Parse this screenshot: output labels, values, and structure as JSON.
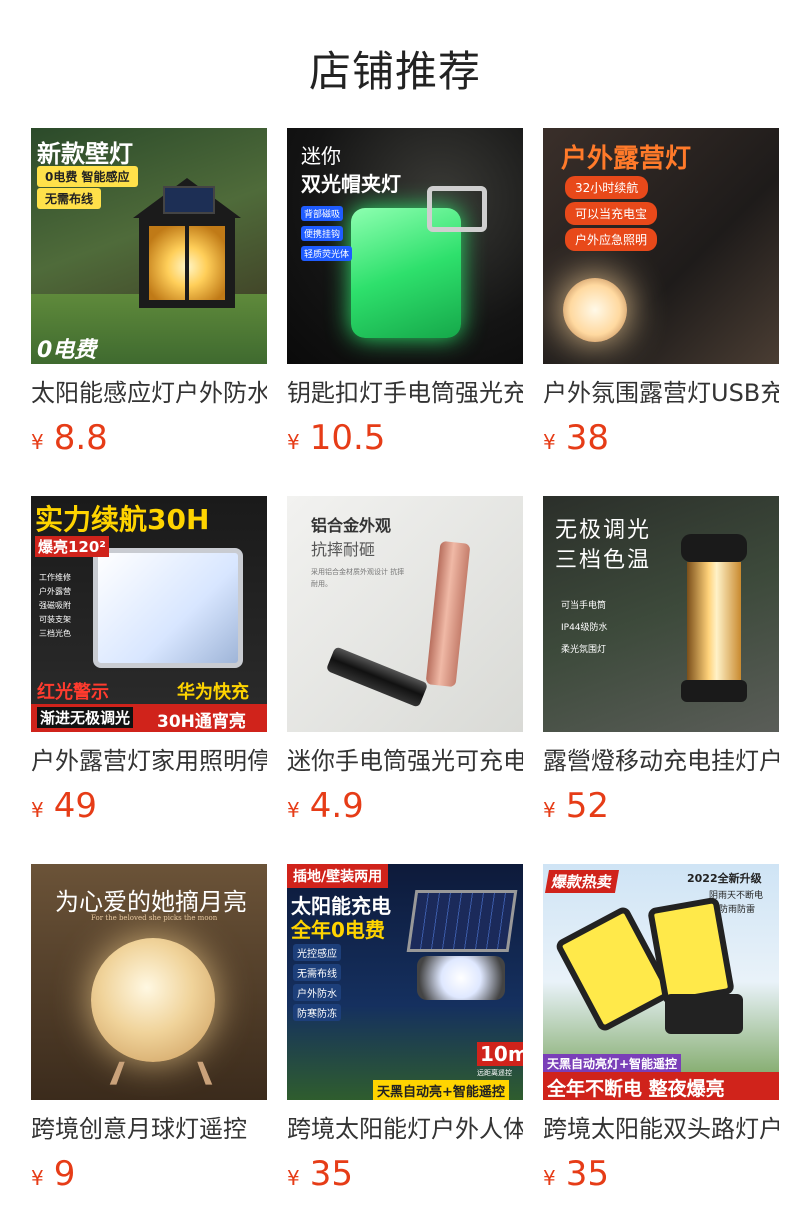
{
  "header": {
    "title": "店铺推荐"
  },
  "products": [
    {
      "name": "太阳能感应灯户外防水",
      "price": "8.8",
      "currency": "¥",
      "image": {
        "headline": "新款壁灯",
        "tags": [
          "0电费 智能感应",
          "无需布线"
        ],
        "footer": "0电费"
      }
    },
    {
      "name": "钥匙扣灯手电筒强光充电",
      "price": "10.5",
      "currency": "¥",
      "image": {
        "headline_small": "迷你",
        "headline": "双光帽夹灯",
        "bullets": [
          "背部磁吸",
          "便携挂钩",
          "轻质荧光体"
        ]
      }
    },
    {
      "name": "户外氛围露营灯USB充电",
      "price": "38",
      "currency": "¥",
      "image": {
        "headline": "户外露营灯",
        "tags": [
          "32小时续航",
          "可以当充电宝",
          "户外应急照明"
        ]
      }
    },
    {
      "name": "户外露营灯家用照明停电",
      "price": "49",
      "currency": "¥",
      "image": {
        "headline": "实力续航30H",
        "sub": "爆亮120²",
        "bullets": [
          "工作维修",
          "户外露营",
          "强磁吸附",
          "可装支架",
          "三档光色"
        ],
        "left_badge": "红光警示",
        "right_badge": "华为快充",
        "footer_left": "渐进无极调光",
        "footer_right": "30H通宵亮"
      }
    },
    {
      "name": "迷你手电筒强光可充电",
      "price": "4.9",
      "currency": "¥",
      "image": {
        "headline": "铝合金外观",
        "sub": "抗摔耐砸",
        "desc": "采用铝合金材质外观设计 抗摔耐用。"
      }
    },
    {
      "name": "露營燈移动充电挂灯户外",
      "price": "52",
      "currency": "¥",
      "image": {
        "headline": "无极调光",
        "sub": "三档色温",
        "bullets": [
          "可当手电筒",
          "IP44级防水",
          "柔光氛围灯"
        ]
      }
    },
    {
      "name": "跨境创意月球灯遥控",
      "price": "9",
      "currency": "¥",
      "image": {
        "headline": "为心爱的她摘月亮",
        "sub": "For the beloved she picks the moon"
      }
    },
    {
      "name": "跨境太阳能灯户外人体感应",
      "price": "35",
      "currency": "¥",
      "image": {
        "corner": "插地/壁装两用",
        "headline": "太阳能充电",
        "sub": "全年0电费",
        "bullets": [
          "光控感应",
          "无需布线",
          "户外防水",
          "防寒防冻"
        ],
        "range": "10m",
        "range_sub": "远距离遥控",
        "footer": "天黑自动亮+智能遥控"
      }
    },
    {
      "name": "跨境太阳能双头路灯户外",
      "price": "35",
      "currency": "¥",
      "image": {
        "corner": "爆款热卖",
        "top_right": "2022全新升级",
        "top_right_sub1": "阴雨天不断电",
        "top_right_sub2": "防雨防雷",
        "band": "天黑自动亮灯+智能遥控",
        "footer": "全年不断电 整夜爆亮"
      }
    }
  ],
  "colors": {
    "price": "#e63c17",
    "title": "#222222"
  }
}
